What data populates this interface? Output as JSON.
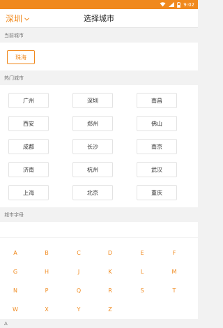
{
  "status_bar": {
    "time": "9:02"
  },
  "header": {
    "current_city": "深圳",
    "title": "选择城市"
  },
  "current_section": {
    "title": "当前城市",
    "city": "珠海"
  },
  "hot_section": {
    "title": "热门城市",
    "cities": [
      "广州",
      "深圳",
      "南昌",
      "西安",
      "郑州",
      "佛山",
      "成都",
      "长沙",
      "南京",
      "济南",
      "杭州",
      "武汉",
      "上海",
      "北京",
      "重庆"
    ]
  },
  "letters_section": {
    "title": "城市字母",
    "letters": [
      "A",
      "B",
      "C",
      "D",
      "E",
      "F",
      "G",
      "H",
      "J",
      "K",
      "L",
      "M",
      "N",
      "P",
      "Q",
      "R",
      "S",
      "T",
      "W",
      "X",
      "Y",
      "Z"
    ]
  },
  "list": {
    "first_group": "A"
  },
  "colors": {
    "accent": "#f0891d",
    "background": "#f2f2f2",
    "panel": "#ffffff"
  }
}
